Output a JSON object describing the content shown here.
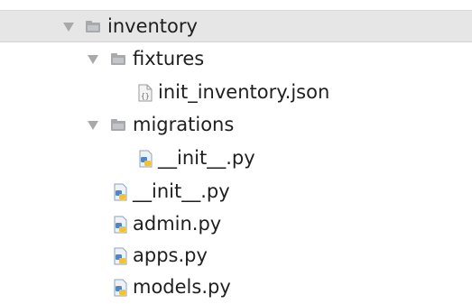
{
  "tree": {
    "items": [
      {
        "label": "inventory",
        "type": "folder",
        "expanded": true,
        "selected": true
      },
      {
        "label": "fixtures",
        "type": "folder",
        "expanded": true
      },
      {
        "label": "init_inventory.json",
        "type": "json-file"
      },
      {
        "label": "migrations",
        "type": "folder",
        "expanded": true
      },
      {
        "label": "__init__.py",
        "type": "python-file"
      },
      {
        "label": "__init__.py",
        "type": "python-file"
      },
      {
        "label": "admin.py",
        "type": "python-file"
      },
      {
        "label": "apps.py",
        "type": "python-file"
      },
      {
        "label": "models.py",
        "type": "python-file"
      }
    ]
  },
  "colors": {
    "selection_background": "#e6e6e6",
    "folder_icon": "#a7a9ac",
    "python_blue": "#4f86c6",
    "python_yellow": "#f2c230",
    "text": "#1f1f1f"
  }
}
